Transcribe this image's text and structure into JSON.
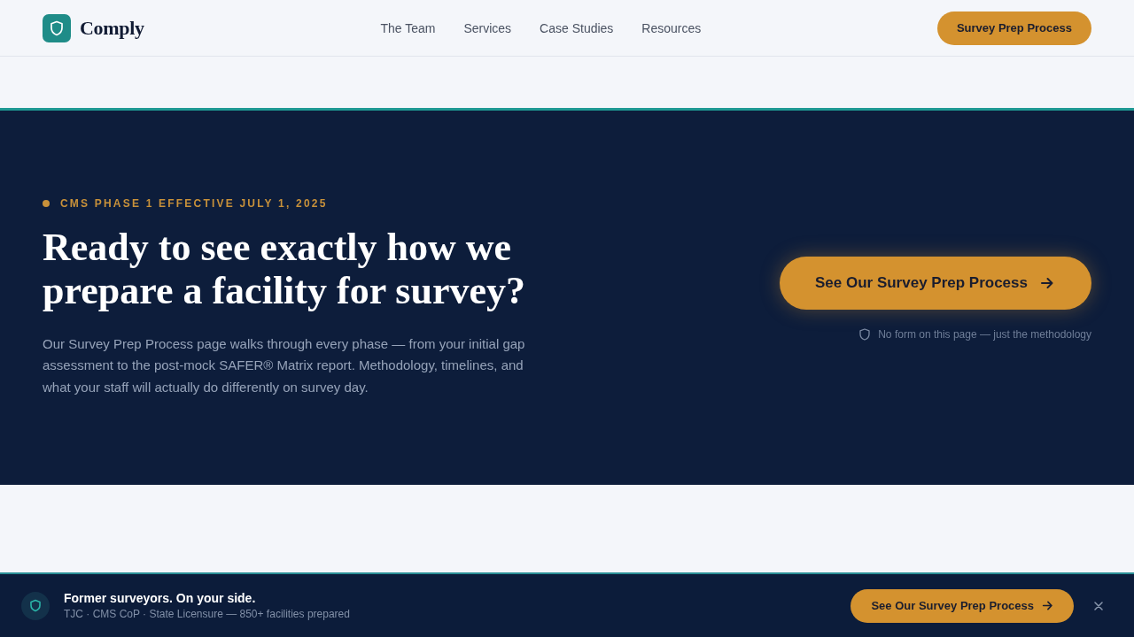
{
  "header": {
    "logo": "Comply",
    "nav": [
      "The Team",
      "Services",
      "Case Studies",
      "Resources"
    ],
    "cta": "Survey Prep Process"
  },
  "hero": {
    "eyebrow": "CMS PHASE 1 EFFECTIVE JULY 1, 2025",
    "heading": "Ready to see exactly how we prepare a facility for survey?",
    "body": "Our Survey Prep Process page walks through every phase — from your initial gap assessment to the post-mock SAFER® Matrix report. Methodology, timelines, and what your staff will actually do differently on survey day.",
    "cta": "See Our Survey Prep Process",
    "note": "No form on this page — just the methodology"
  },
  "bottom_bar": {
    "title": "Former surveyors. On your side.",
    "subtitle": "TJC · CMS CoP · State Licensure — 850+ facilities prepared",
    "cta": "See Our Survey Prep Process"
  }
}
